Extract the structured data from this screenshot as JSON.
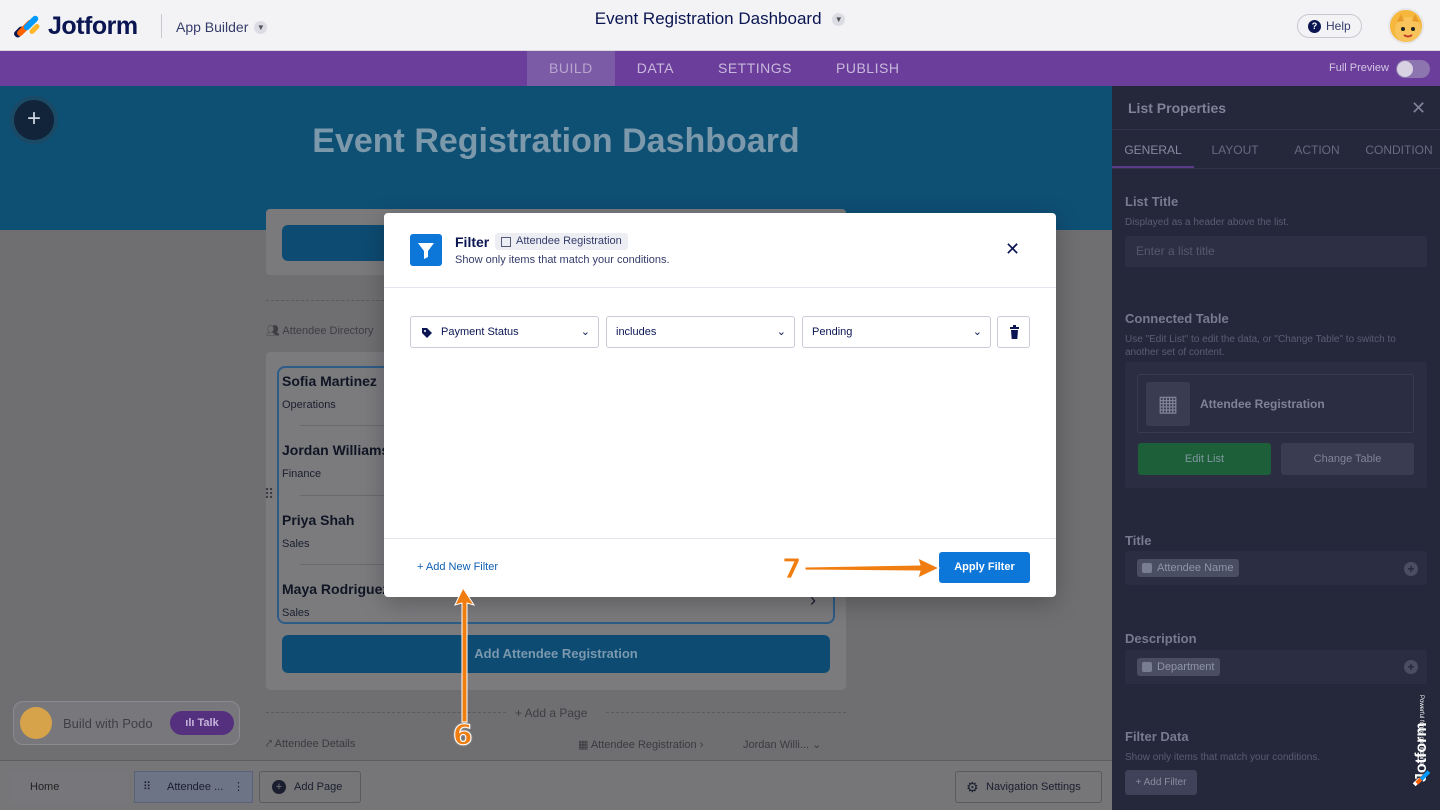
{
  "topbar": {
    "brand": "Jotform",
    "app_builder": "App Builder",
    "doc_title": "Event Registration Dashboard",
    "help": "Help"
  },
  "nav": {
    "tabs": [
      "BUILD",
      "DATA",
      "SETTINGS",
      "PUBLISH"
    ],
    "active": "BUILD",
    "full_preview": "Full Preview"
  },
  "canvas": {
    "hero_title": "Event Registration Dashboard",
    "directory_label": "Attendee Directory",
    "list_items": [
      {
        "name": "Sofia Martinez",
        "dept": "Operations"
      },
      {
        "name": "Jordan Williams",
        "dept": "Finance"
      },
      {
        "name": "Priya Shah",
        "dept": "Sales"
      },
      {
        "name": "Maya Rodriguez",
        "dept": "Sales"
      }
    ],
    "add_button": "Add Attendee Registration",
    "add_page": "+ Add a Page",
    "details_label": "Attendee Details",
    "details_table": "Attendee Registration",
    "details_record": "Jordan Willi...",
    "podo_text": "Build with Podo",
    "podo_talk": "Talk"
  },
  "pagebar": {
    "home": "Home",
    "current": "Attendee ...",
    "add_page": "Add Page",
    "nav_settings": "Navigation Settings"
  },
  "rpanel": {
    "title": "List Properties",
    "tabs": [
      "GENERAL",
      "LAYOUT",
      "ACTION",
      "CONDITION"
    ],
    "list_title_h": "List Title",
    "list_title_s": "Displayed as a header above the list.",
    "list_title_placeholder": "Enter a list title",
    "connected_h": "Connected Table",
    "connected_s": "Use \"Edit List\" to edit the data, or \"Change Table\" to switch to another set of content.",
    "connected_table": "Attendee Registration",
    "edit_list": "Edit List",
    "change_table": "Change Table",
    "title_h": "Title",
    "title_chip": "Attendee Name",
    "desc_h": "Description",
    "desc_chip": "Department",
    "filter_h": "Filter Data",
    "filter_s": "Show only items that match your conditions.",
    "add_filter": "Add Filter",
    "side_brand": "Jotform",
    "side_tagline": "Powerful forms get it done."
  },
  "modal": {
    "title": "Filter",
    "badge": "Attendee Registration",
    "subtitle": "Show only items that match your conditions.",
    "field": "Payment Status",
    "operator": "includes",
    "value": "Pending",
    "add_new_filter": "+ Add New Filter",
    "apply": "Apply Filter"
  },
  "annotations": {
    "step6": "6",
    "step7": "7",
    "color": "#f07d0f"
  },
  "colors": {
    "nav_purple": "#6a3e9a",
    "primary_blue": "#0d77d9",
    "hero_blue": "#0e4f74",
    "panel_dark": "#25283a"
  }
}
